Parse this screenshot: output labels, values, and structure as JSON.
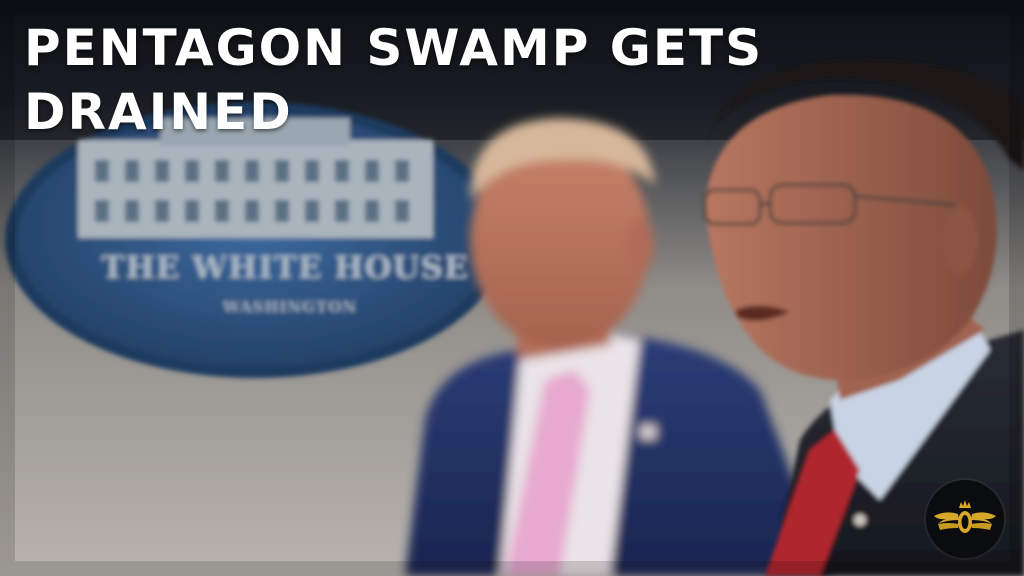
{
  "headline": {
    "line1": "PENTAGON SWAMP GETS",
    "line2": "DRAINED"
  },
  "seal": {
    "text_main": "THE WHITE HOUSE",
    "text_sub": "WASHINGTON",
    "color": "#2e4f7c"
  },
  "logo": {
    "icon": "winged-emblem-icon",
    "color": "#d6a728"
  }
}
